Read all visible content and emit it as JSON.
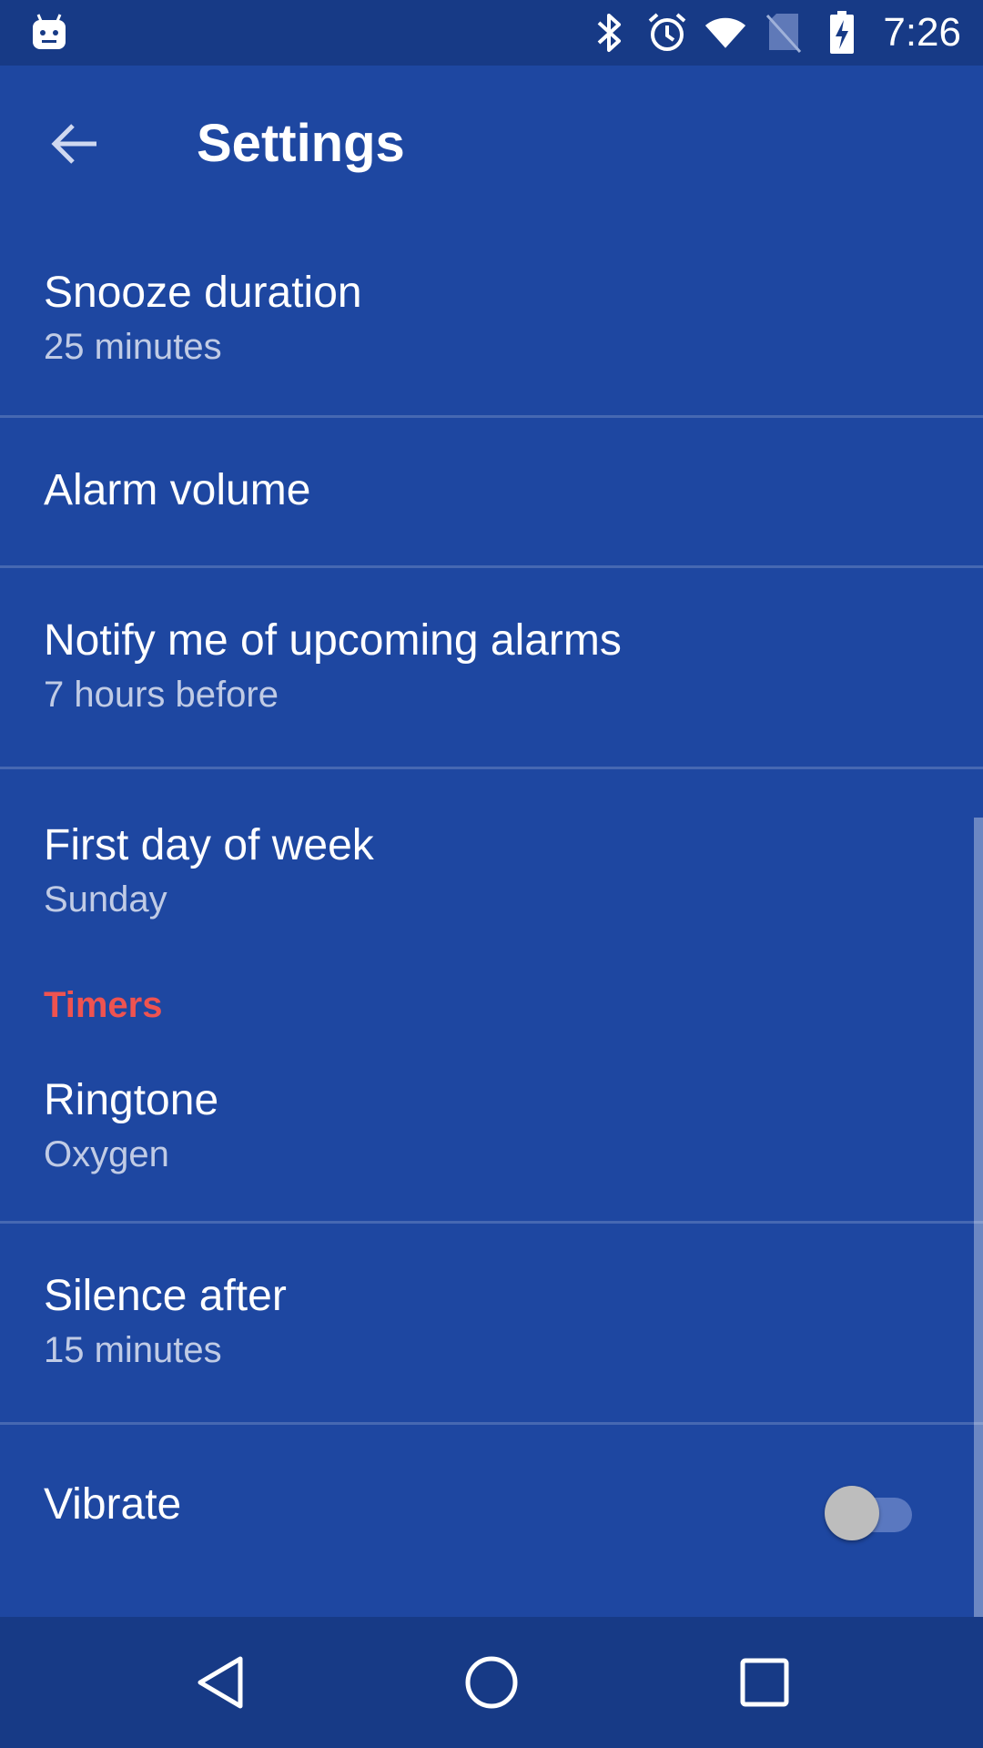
{
  "status_bar": {
    "time": "7:26",
    "icons": [
      "android-icon",
      "bluetooth-icon",
      "alarm-clock-icon",
      "wifi-icon",
      "no-sim-icon",
      "battery-charging-icon"
    ]
  },
  "header": {
    "title": "Settings",
    "back_icon": "arrow-left-icon"
  },
  "settings": [
    {
      "title": "Snooze duration",
      "summary": "25 minutes"
    },
    {
      "title": "Alarm volume"
    },
    {
      "title": "Notify me of upcoming alarms",
      "summary": "7 hours before"
    },
    {
      "title": "First day of week",
      "summary": "Sunday"
    }
  ],
  "timers": {
    "header": "Timers",
    "items": [
      {
        "title": "Ringtone",
        "summary": "Oxygen"
      },
      {
        "title": "Silence after",
        "summary": "15 minutes"
      },
      {
        "title": "Vibrate",
        "toggle_on": false
      }
    ]
  },
  "nav_bar": {
    "icons": [
      "back-triangle-icon",
      "home-circle-icon",
      "recents-square-icon"
    ]
  },
  "colors": {
    "background": "#1e47a1",
    "bars": "#173a86",
    "accent": "#ef5350"
  }
}
